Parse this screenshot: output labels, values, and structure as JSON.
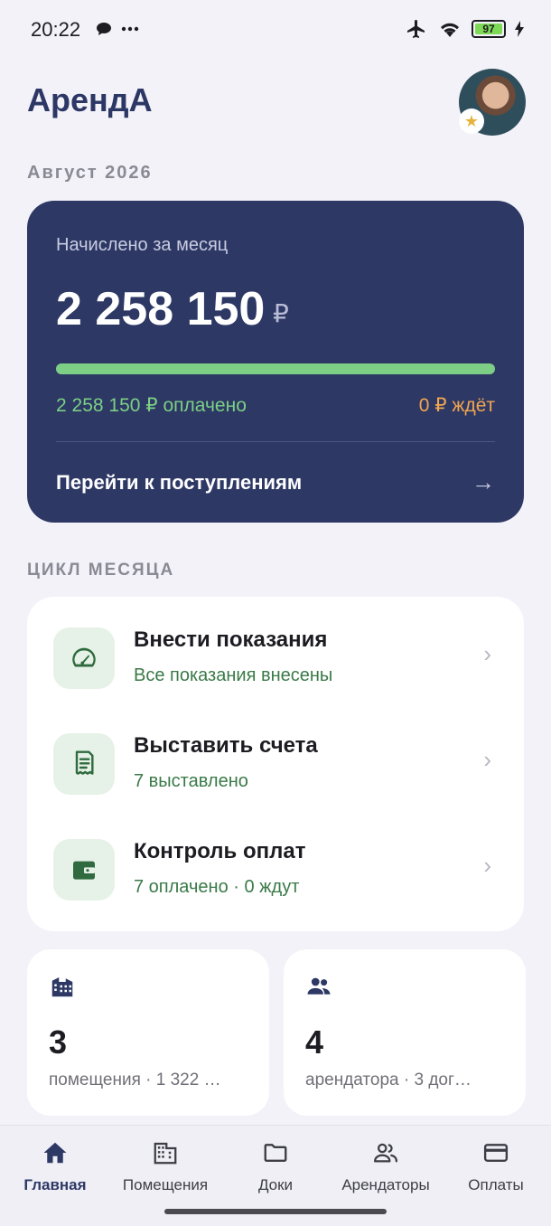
{
  "status_bar": {
    "time": "20:22",
    "battery": "97"
  },
  "header": {
    "app_title": "АрендА"
  },
  "month": "Август 2026",
  "summary": {
    "label": "Начислено за месяц",
    "amount": "2 258 150",
    "currency": "₽",
    "paid_fraction": 1.0,
    "paid_text": "2 258 150 ₽ оплачено",
    "waiting_text": "0 ₽ ждёт",
    "goto_label": "Перейти к поступлениям"
  },
  "cycle": {
    "section_label": "ЦИКЛ МЕСЯЦА",
    "items": [
      {
        "title": "Внести показания",
        "subtitle": "Все показания внесены",
        "icon": "gauge-icon"
      },
      {
        "title": "Выставить счета",
        "subtitle": "7 выставлено",
        "icon": "receipt-icon"
      },
      {
        "title": "Контроль оплат",
        "subtitle": "7 оплачено · 0 ждут",
        "icon": "wallet-icon"
      }
    ]
  },
  "stats": [
    {
      "number": "3",
      "subtitle": "помещения · 1 322 …",
      "icon": "building-icon"
    },
    {
      "number": "4",
      "subtitle": "арендатора · 3 дог…",
      "icon": "people-icon"
    }
  ],
  "nav": [
    {
      "label": "Главная",
      "icon": "home-icon",
      "active": true
    },
    {
      "label": "Помещения",
      "icon": "building-icon",
      "active": false
    },
    {
      "label": "Доки",
      "icon": "folder-icon",
      "active": false
    },
    {
      "label": "Арендаторы",
      "icon": "people-icon",
      "active": false
    },
    {
      "label": "Оплаты",
      "icon": "card-icon",
      "active": false
    }
  ],
  "colors": {
    "accent": "#2d3865",
    "paid": "#7ccf84",
    "waiting": "#f1a550",
    "cycle_icon_bg": "#e6f1e7",
    "cycle_subtitle": "#3a7a48"
  }
}
